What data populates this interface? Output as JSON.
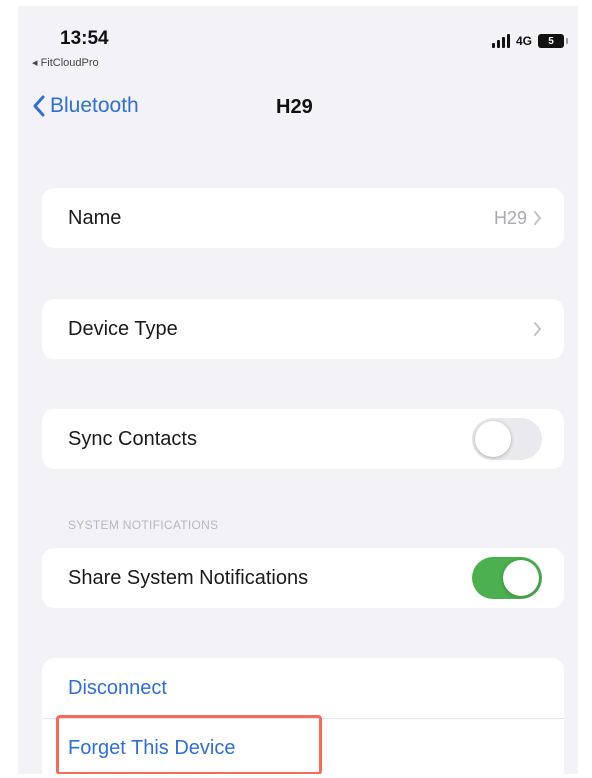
{
  "status_bar": {
    "time": "13:54",
    "back_app": "FitCloudPro",
    "network": "4G",
    "battery": "5"
  },
  "nav": {
    "back_label": "Bluetooth",
    "title": "H29"
  },
  "rows": {
    "name": {
      "label": "Name",
      "value": "H29"
    },
    "device_type": {
      "label": "Device Type"
    },
    "sync_contacts": {
      "label": "Sync Contacts",
      "toggle_on": false
    }
  },
  "system_notifications": {
    "header": "SYSTEM NOTIFICATIONS",
    "share": {
      "label": "Share System Notifications",
      "toggle_on": true
    }
  },
  "actions": {
    "disconnect": "Disconnect",
    "forget": "Forget This Device"
  },
  "colors": {
    "accent": "#2f6fd6",
    "toggle_on": "#4caf50",
    "highlight": "#f26b5b",
    "background": "#f2f2f7"
  }
}
